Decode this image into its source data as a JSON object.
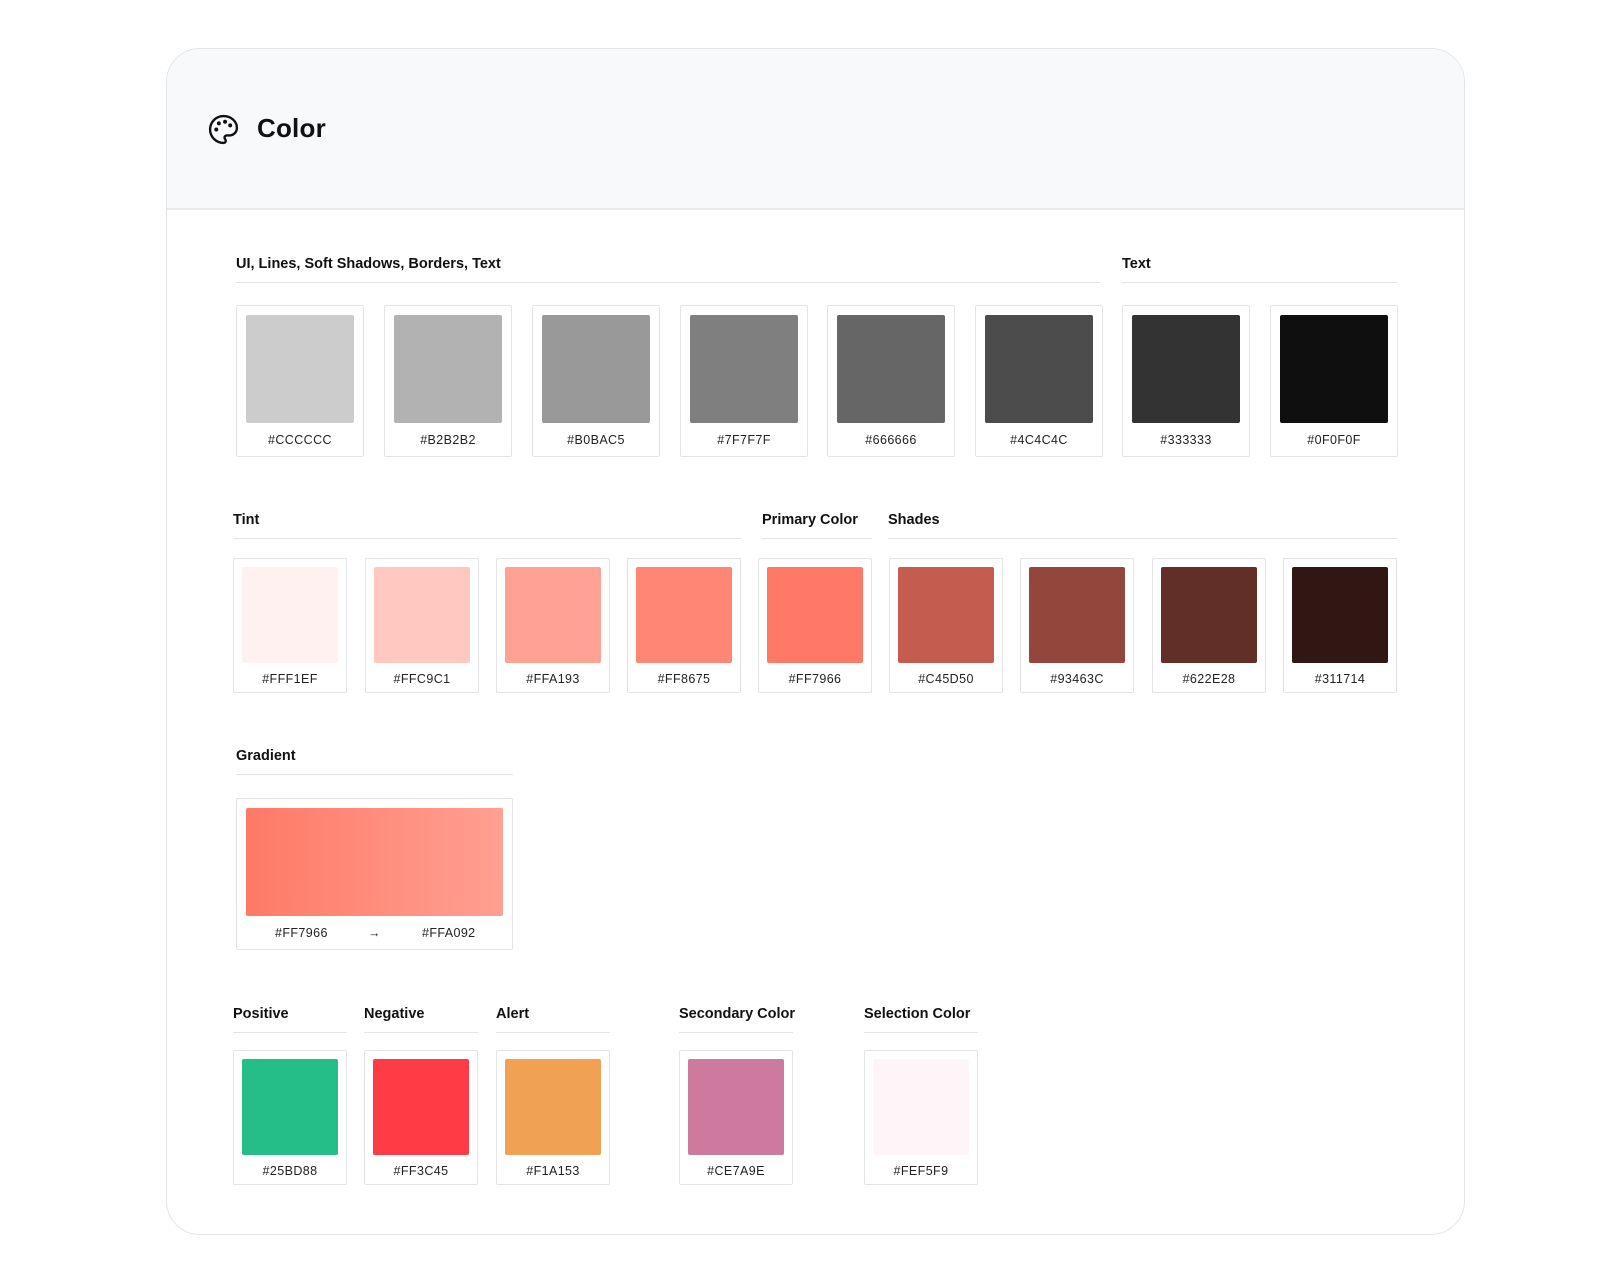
{
  "header": {
    "title": "Color",
    "icon": "palette-icon"
  },
  "sections": {
    "ui": "UI, Lines, Soft Shadows, Borders, Text",
    "text": "Text",
    "tint": "Tint",
    "primary": "Primary Color",
    "shades": "Shades",
    "gradient": "Gradient",
    "positive": "Positive",
    "negative": "Negative",
    "alert": "Alert",
    "secondary": "Secondary Color",
    "selection": "Selection Color"
  },
  "greys": [
    {
      "hex": "#CCCCCC",
      "color": "#CCCCCC"
    },
    {
      "hex": "#B2B2B2",
      "color": "#B2B2B2"
    },
    {
      "hex": "#B0BAC5",
      "color": "#999999"
    },
    {
      "hex": "#7F7F7F",
      "color": "#7F7F7F"
    },
    {
      "hex": "#666666",
      "color": "#666666"
    },
    {
      "hex": "#4C4C4C",
      "color": "#4C4C4C"
    },
    {
      "hex": "#333333",
      "color": "#333333"
    },
    {
      "hex": "#0F0F0F",
      "color": "#0F0F0F"
    }
  ],
  "reds": [
    {
      "hex": "#FFF1EF",
      "color": "#FFF1EF"
    },
    {
      "hex": "#FFC9C1",
      "color": "#FFC9C1"
    },
    {
      "hex": "#FFA193",
      "color": "#FFA193"
    },
    {
      "hex": "#FF8675",
      "color": "#FF8675"
    },
    {
      "hex": "#FF7966",
      "color": "#FF7966"
    },
    {
      "hex": "#C45D50",
      "color": "#C45D50"
    },
    {
      "hex": "#93463C",
      "color": "#93463C"
    },
    {
      "hex": "#622E28",
      "color": "#622E28"
    },
    {
      "hex": "#311714",
      "color": "#311714"
    }
  ],
  "gradient": {
    "from": "#FF7966",
    "arrow": "→",
    "to": "#FFA092"
  },
  "status": [
    {
      "hex": "#25BD88",
      "color": "#25BD88"
    },
    {
      "hex": "#FF3C45",
      "color": "#FF3C45"
    },
    {
      "hex": "#F1A153",
      "color": "#F1A153"
    },
    {
      "hex": "#CE7A9E",
      "color": "#CE7A9E"
    },
    {
      "hex": "#FEF5F9",
      "color": "#FEF5F9"
    }
  ]
}
